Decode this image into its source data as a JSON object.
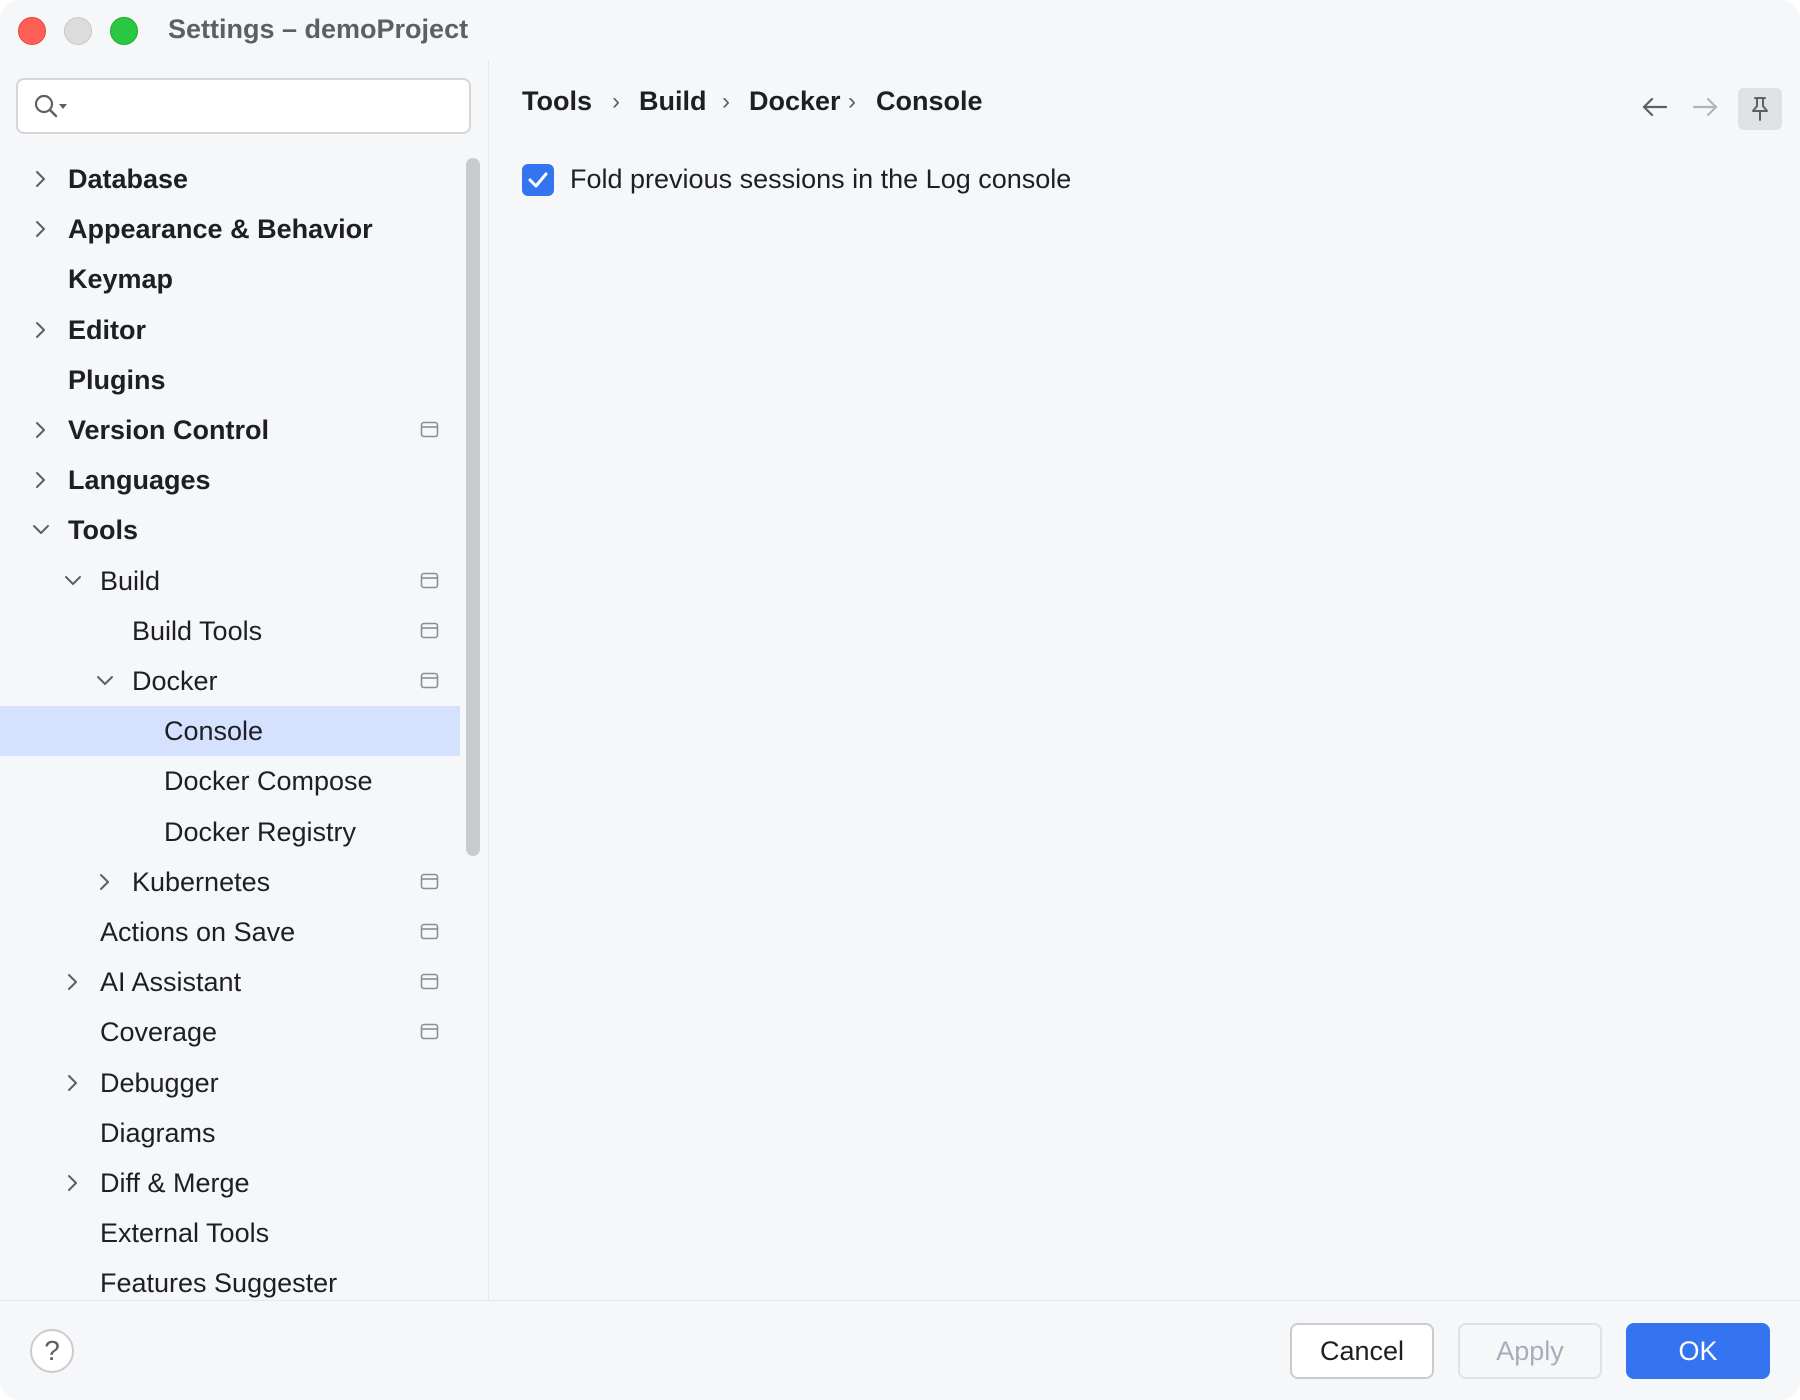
{
  "window": {
    "title": "Settings – demoProject"
  },
  "search": {
    "placeholder": ""
  },
  "sidebar": {
    "items": [
      {
        "label": "Database",
        "bold": true,
        "level": 0,
        "expander": "collapsed",
        "project": false,
        "selected": false
      },
      {
        "label": "Appearance & Behavior",
        "bold": true,
        "level": 0,
        "expander": "collapsed",
        "project": false,
        "selected": false
      },
      {
        "label": "Keymap",
        "bold": true,
        "level": 0,
        "expander": "none",
        "project": false,
        "selected": false
      },
      {
        "label": "Editor",
        "bold": true,
        "level": 0,
        "expander": "collapsed",
        "project": false,
        "selected": false
      },
      {
        "label": "Plugins",
        "bold": true,
        "level": 0,
        "expander": "none",
        "project": false,
        "selected": false
      },
      {
        "label": "Version Control",
        "bold": true,
        "level": 0,
        "expander": "collapsed",
        "project": true,
        "selected": false
      },
      {
        "label": "Languages",
        "bold": true,
        "level": 0,
        "expander": "collapsed",
        "project": false,
        "selected": false
      },
      {
        "label": "Tools",
        "bold": true,
        "level": 0,
        "expander": "expanded",
        "project": false,
        "selected": false
      },
      {
        "label": "Build",
        "bold": false,
        "level": 1,
        "expander": "expanded",
        "project": true,
        "selected": false
      },
      {
        "label": "Build Tools",
        "bold": false,
        "level": 2,
        "expander": "none",
        "project": true,
        "selected": false
      },
      {
        "label": "Docker",
        "bold": false,
        "level": 2,
        "expander": "expanded",
        "project": true,
        "selected": false
      },
      {
        "label": "Console",
        "bold": false,
        "level": 3,
        "expander": "none",
        "project": false,
        "selected": true
      },
      {
        "label": "Docker Compose",
        "bold": false,
        "level": 3,
        "expander": "none",
        "project": false,
        "selected": false
      },
      {
        "label": "Docker Registry",
        "bold": false,
        "level": 3,
        "expander": "none",
        "project": false,
        "selected": false
      },
      {
        "label": "Kubernetes",
        "bold": false,
        "level": 2,
        "expander": "collapsed",
        "project": true,
        "selected": false
      },
      {
        "label": "Actions on Save",
        "bold": false,
        "level": 1,
        "expander": "none",
        "project": true,
        "selected": false
      },
      {
        "label": "AI Assistant",
        "bold": false,
        "level": 1,
        "expander": "collapsed",
        "project": true,
        "selected": false
      },
      {
        "label": "Coverage",
        "bold": false,
        "level": 1,
        "expander": "none",
        "project": true,
        "selected": false
      },
      {
        "label": "Debugger",
        "bold": false,
        "level": 1,
        "expander": "collapsed",
        "project": false,
        "selected": false
      },
      {
        "label": "Diagrams",
        "bold": false,
        "level": 1,
        "expander": "none",
        "project": false,
        "selected": false
      },
      {
        "label": "Diff & Merge",
        "bold": false,
        "level": 1,
        "expander": "collapsed",
        "project": false,
        "selected": false
      },
      {
        "label": "External Tools",
        "bold": false,
        "level": 1,
        "expander": "none",
        "project": false,
        "selected": false
      },
      {
        "label": "Features Suggester",
        "bold": false,
        "level": 1,
        "expander": "none",
        "project": false,
        "selected": false
      }
    ]
  },
  "breadcrumb": {
    "items": [
      "Tools",
      "Build",
      "Docker",
      "Console"
    ],
    "separator": "›"
  },
  "content": {
    "fold_sessions": {
      "label": "Fold previous sessions in the Log console",
      "checked": true
    }
  },
  "footer": {
    "help_label": "?",
    "cancel_label": "Cancel",
    "apply_label": "Apply",
    "ok_label": "OK"
  },
  "colors": {
    "accent": "#3574f0",
    "selection": "#d4e2ff",
    "background": "#f6f7f9"
  }
}
